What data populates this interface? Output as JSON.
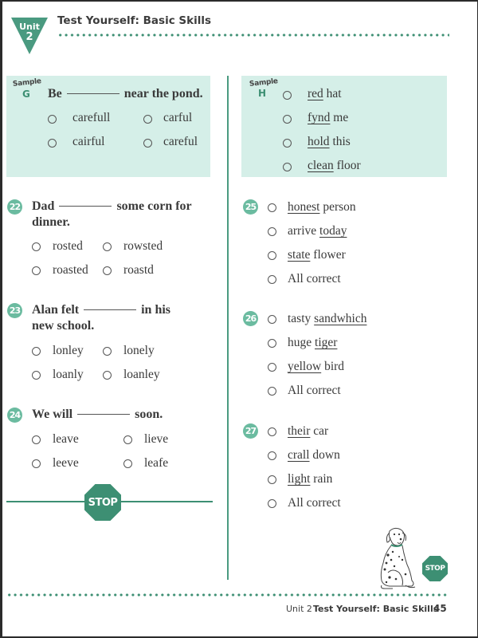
{
  "header": {
    "unit_word": "Unit",
    "unit_number": "2",
    "title": "Test Yourself: Basic Skills"
  },
  "colors": {
    "accent": "#3d8f73",
    "number_circle": "#6bbba0",
    "sample_background": "#d5efe8",
    "text": "#3a3a3a"
  },
  "sample_g": {
    "sample_word": "Sample",
    "letter": "G",
    "prompt_before": "Be",
    "prompt_after": "near the pond.",
    "options": [
      "carefull",
      "carful",
      "cairful",
      "careful"
    ]
  },
  "sample_h": {
    "sample_word": "Sample",
    "letter": "H",
    "options": [
      {
        "underlined": "red",
        "rest": " hat"
      },
      {
        "underlined": "fynd",
        "rest": " me"
      },
      {
        "underlined": "hold",
        "rest": " this"
      },
      {
        "underlined": "clean",
        "rest": " floor"
      }
    ]
  },
  "questions_left": [
    {
      "number": "22",
      "prompt_before": "Dad",
      "prompt_after": "some corn for",
      "prompt_line2": "dinner.",
      "options": [
        "rosted",
        "rowsted",
        "roasted",
        "roastd"
      ]
    },
    {
      "number": "23",
      "prompt_before": "Alan felt",
      "prompt_after": "in his",
      "prompt_line2": "new school.",
      "options": [
        "lonley",
        "lonely",
        "loanly",
        "loanley"
      ]
    },
    {
      "number": "24",
      "prompt_before": "We will",
      "prompt_after": "soon.",
      "options": [
        "leave",
        "lieve",
        "leeve",
        "leafe"
      ]
    }
  ],
  "questions_right": [
    {
      "number": "25",
      "options": [
        {
          "before": "",
          "underlined": "honest",
          "after": " person"
        },
        {
          "before": "arrive ",
          "underlined": "today",
          "after": ""
        },
        {
          "before": "",
          "underlined": "state",
          "after": " flower"
        },
        {
          "before": "All correct",
          "underlined": "",
          "after": ""
        }
      ]
    },
    {
      "number": "26",
      "options": [
        {
          "before": "tasty ",
          "underlined": "sandwhich",
          "after": ""
        },
        {
          "before": "huge ",
          "underlined": "tiger",
          "after": ""
        },
        {
          "before": "",
          "underlined": "yellow",
          "after": " bird"
        },
        {
          "before": "All correct",
          "underlined": "",
          "after": ""
        }
      ]
    },
    {
      "number": "27",
      "options": [
        {
          "before": "",
          "underlined": "their",
          "after": " car"
        },
        {
          "before": "",
          "underlined": "crall",
          "after": " down"
        },
        {
          "before": "",
          "underlined": "light",
          "after": " rain"
        },
        {
          "before": "All correct",
          "underlined": "",
          "after": ""
        }
      ]
    }
  ],
  "stop_sign_label": "STOP",
  "footer": {
    "unit": "Unit 2",
    "title": "Test Yourself: Basic Skills",
    "page_number": "45"
  }
}
